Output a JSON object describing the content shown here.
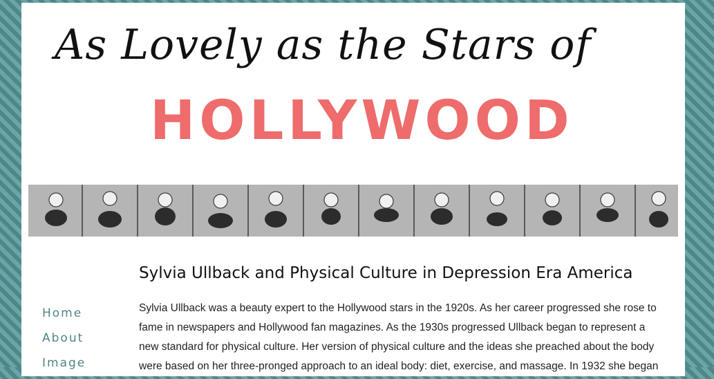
{
  "header": {
    "title_script": "As Lovely as the Stars of",
    "title_marquee": "HOLLYWOOD",
    "marquee_color": "#ee6c6c"
  },
  "banner": {
    "image": "vintage comic strip of exercising women"
  },
  "nav": {
    "items": [
      {
        "label": "Home"
      },
      {
        "label": "About"
      },
      {
        "label": "Image"
      }
    ]
  },
  "post": {
    "title": "Sylvia Ullback and Physical Culture in Depression Era America",
    "body": "Sylvia Ullback was a beauty expert to the Hollywood stars in the 1920s. As her career progressed she rose to fame in newspapers and Hollywood fan magazines. As the 1930s progressed Ullback began to represent a new standard for physical culture. Her version of physical culture and the ideas she preached about the body were based on her three-pronged approach to an ideal body: diet, exercise, and massage. In 1932 she began"
  },
  "colors": {
    "background": "#5f9a9c",
    "nav_text": "#4f8587"
  }
}
